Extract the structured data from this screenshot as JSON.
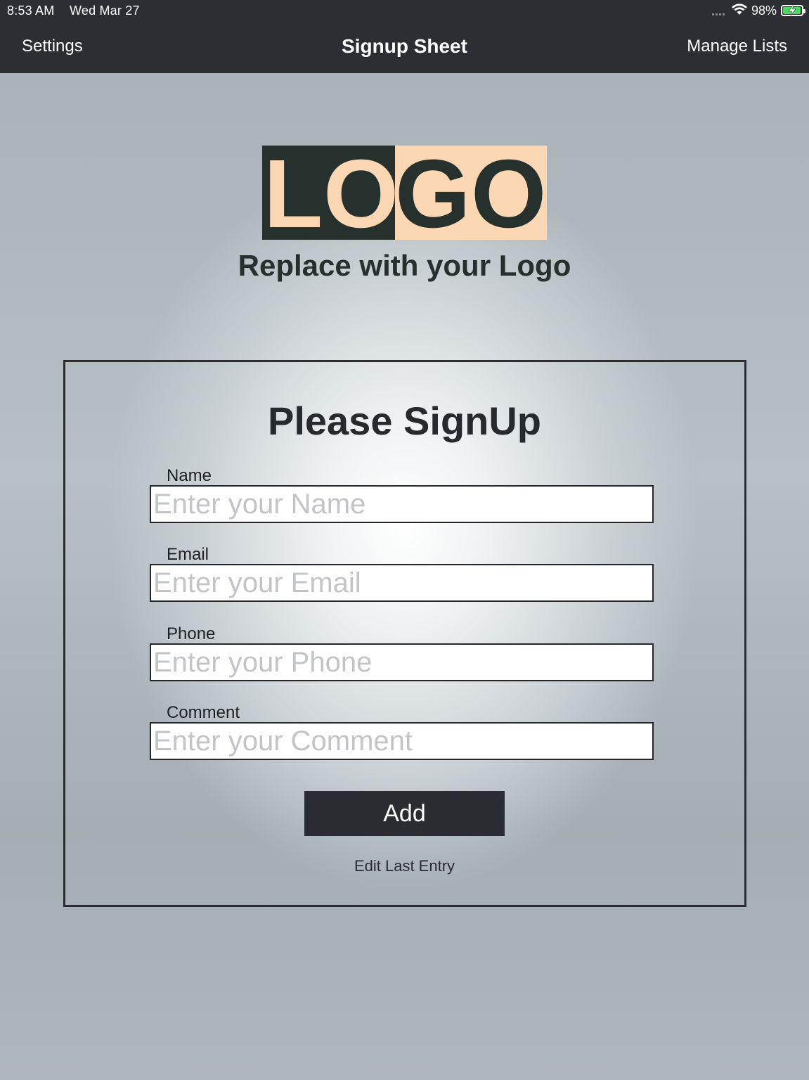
{
  "status_bar": {
    "time": "8:53 AM",
    "date": "Wed Mar 27",
    "battery_percent_text": "98%",
    "battery_level": 0.98,
    "wifi_icon": "wifi-icon",
    "signal_icon": "cellular-signal-dots-icon"
  },
  "nav": {
    "left_button": "Settings",
    "title": "Signup Sheet",
    "right_button": "Manage Lists"
  },
  "logo": {
    "letters": [
      "L",
      "O",
      "G",
      "O"
    ],
    "caption": "Replace with your Logo",
    "colors": {
      "dark": "#26302c",
      "light": "#fbd8b3"
    }
  },
  "form": {
    "title": "Please SignUp",
    "fields": [
      {
        "label": "Name",
        "placeholder": "Enter your Name",
        "value": ""
      },
      {
        "label": "Email",
        "placeholder": "Enter your Email",
        "value": ""
      },
      {
        "label": "Phone",
        "placeholder": "Enter your Phone",
        "value": ""
      },
      {
        "label": "Comment",
        "placeholder": "Enter your Comment",
        "value": ""
      }
    ],
    "add_button": "Add",
    "edit_link": "Edit Last Entry"
  },
  "colors": {
    "nav_background": "#2c2e33",
    "button_background": "#2a2c31",
    "battery_fill": "#4cd964"
  }
}
